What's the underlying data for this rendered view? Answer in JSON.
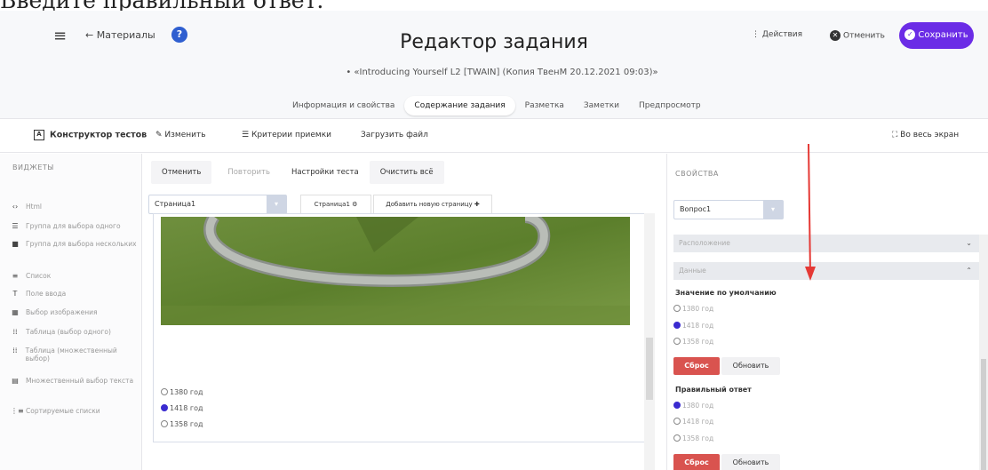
{
  "caption": "Введите правильный ответ.",
  "header": {
    "back_label": "Материалы",
    "title": "Редактор задания",
    "subtitle": "• «Introducing Yourself L2 [TWAIN] (Копия ТвенМ 20.12.2021 09:03)»",
    "actions_label": "Действия",
    "cancel_label": "Отменить",
    "save_label": "Сохранить",
    "tabs": [
      "Информация и свойства",
      "Содержание задания",
      "Разметка",
      "Заметки",
      "Предпросмотр"
    ],
    "active_tab": 1
  },
  "toolbar": {
    "constructor_label": "Конструктор тестов",
    "edit_label": "Изменить",
    "criteria_label": "Критерии приемки",
    "upload_label": "Загрузить файл",
    "fullscreen_label": "Во весь экран"
  },
  "widgets": {
    "title": "ВИДЖЕТЫ",
    "items": [
      {
        "icon": "html-icon",
        "glyph": "‹›",
        "label": "Html"
      },
      {
        "icon": "single-choice-icon",
        "glyph": "☰",
        "label": "Группа для выбора одного"
      },
      {
        "icon": "multi-choice-icon",
        "glyph": "■",
        "label": "Группа для выбора нескольких"
      },
      {
        "icon": "list-icon",
        "glyph": "≡",
        "label": "Список"
      },
      {
        "icon": "text-input-icon",
        "glyph": "T",
        "label": "Поле ввода"
      },
      {
        "icon": "image-choice-icon",
        "glyph": "▦",
        "label": "Выбор изображения"
      },
      {
        "icon": "table-single-icon",
        "glyph": "⁞⁞",
        "label": "Таблица (выбор одного)"
      },
      {
        "icon": "table-multi-icon",
        "glyph": "⁞⁞",
        "label": "Таблица (множественный выбор)"
      },
      {
        "icon": "multi-text-icon",
        "glyph": "▤",
        "label": "Множественный выбор текста"
      },
      {
        "icon": "sortable-list-icon",
        "glyph": "⋮≡",
        "label": "Сортируемые списки"
      }
    ]
  },
  "editor": {
    "undo_label": "Отменить",
    "redo_label": "Повторить",
    "settings_label": "Настройки теста",
    "clear_label": "Очистить всё",
    "page_select_value": "Страница1",
    "page_tab_label": "Страница1 ⚙",
    "add_page_label": "Добавить новую страницу ✚",
    "options": [
      "1380 год",
      "1418 год",
      "1358 год"
    ],
    "selected_option": 1
  },
  "properties": {
    "title": "СВОЙСТВА",
    "question_select": "Вопрос1",
    "section_layout": "Расположение",
    "section_data": "Данные",
    "default_label": "Значение по умолчанию",
    "default_options": [
      "1380 год",
      "1418 год",
      "1358 год"
    ],
    "default_selected": 1,
    "correct_label": "Правильный ответ",
    "correct_options": [
      "1380 год",
      "1418 год",
      "1358 год"
    ],
    "correct_selected": 0,
    "reset_label": "Сброс",
    "update_label": "Обновить"
  },
  "colors": {
    "accent": "#6b2ce6",
    "reset": "#d9534f",
    "arrow": "#e53935",
    "radio": "#3a2bd0"
  }
}
